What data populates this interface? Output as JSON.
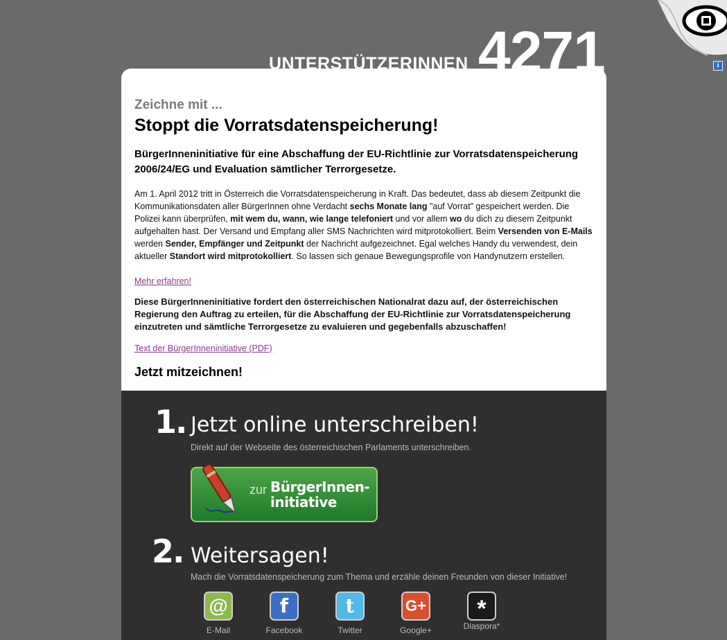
{
  "counter": {
    "label": "UNTERSTÜTZERINNEN",
    "count": "4271"
  },
  "info_icon": "i",
  "card": {
    "pre_title": "Zeichne mit ...",
    "title": "Stoppt die Vorratsdatenspeicherung!",
    "subtitle": "BürgerInneninitiative für eine Abschaffung der EU-Richtlinie zur Vorratsdatenspeicherung 2006/24/EG und Evaluation sämtlicher Terrorgesetze.",
    "body": {
      "p1": "Am 1. April 2012 tritt in Österreich die Vorratsdatenspeicherung in Kraft. Das bedeutet, dass ab diesem Zeitpunkt die Kommunikationsdaten aller BürgerInnen ohne Verdacht ",
      "b1": "sechs Monate lang",
      "p2": " \"auf Vorrat\" gespeichert werden. Die Polizei kann überprüfen, ",
      "b2": "mit wem du, wann, wie lange telefoniert",
      "p3": " und vor allem ",
      "b3": "wo",
      "p4": " du dich zu diesem Zeitpunkt aufgehalten hast. Der Versand und Empfang aller SMS Nachrichten wird mitprotokolliert. Beim ",
      "b4": "Versenden von E-Mails",
      "p5": " werden ",
      "b5": "Sender, Empfänger und Zeitpunkt",
      "p6": " der Nachricht aufgezeichnet. Egal welches Handy du verwendest, dein aktueller ",
      "b6": "Standort wird mitprotokolliert",
      "p7": ". So lassen sich genaue Bewegungsprofile von Handynutzern erstellen."
    },
    "more_link": "Mehr erfahren!",
    "demand": "Diese BürgerInneninitiative fordert den österreichischen Nationalrat dazu auf, der österreichischen Regierung den Auftrag zu erteilen, für die Abschaffung der EU-Richtlinie zur Vorratsdatenspeicherung einzutreten und sämtliche Terrorgesetze zu evaluieren und gegebenfalls abzuschaffen!",
    "pdf_link": "Text der BürgerInneninitiative (PDF)",
    "sign_now": "Jetzt mitzeichnen!"
  },
  "steps": {
    "one": {
      "number": "1.",
      "title": "Jetzt online unterschreiben!",
      "desc": "Direkt auf der Webseite des österreichischen Parlaments unterschreiben.",
      "cta_prefix": "zur",
      "cta_label": "BürgerInnen-initiative"
    },
    "two": {
      "number": "2.",
      "title": "Weitersagen!",
      "desc": "Mach die Vorratsdatenspeicherung zum Thema und erzähle deinen Freunden von dieser Initiative!"
    }
  },
  "share": [
    {
      "label": "E-Mail",
      "glyph": "@",
      "color": "#8cb94a",
      "icon": "email-icon"
    },
    {
      "label": "Facebook",
      "glyph": "f",
      "color": "#3b6fc4",
      "icon": "facebook-icon"
    },
    {
      "label": "Twitter",
      "glyph": "t",
      "color": "#52b8e6",
      "icon": "twitter-icon"
    },
    {
      "label": "Google+",
      "glyph": "G+",
      "color": "#d6502e",
      "icon": "googleplus-icon"
    },
    {
      "label": "Diaspora*",
      "glyph": "*",
      "color": "#1a1a1a",
      "icon": "diaspora-icon"
    }
  ]
}
